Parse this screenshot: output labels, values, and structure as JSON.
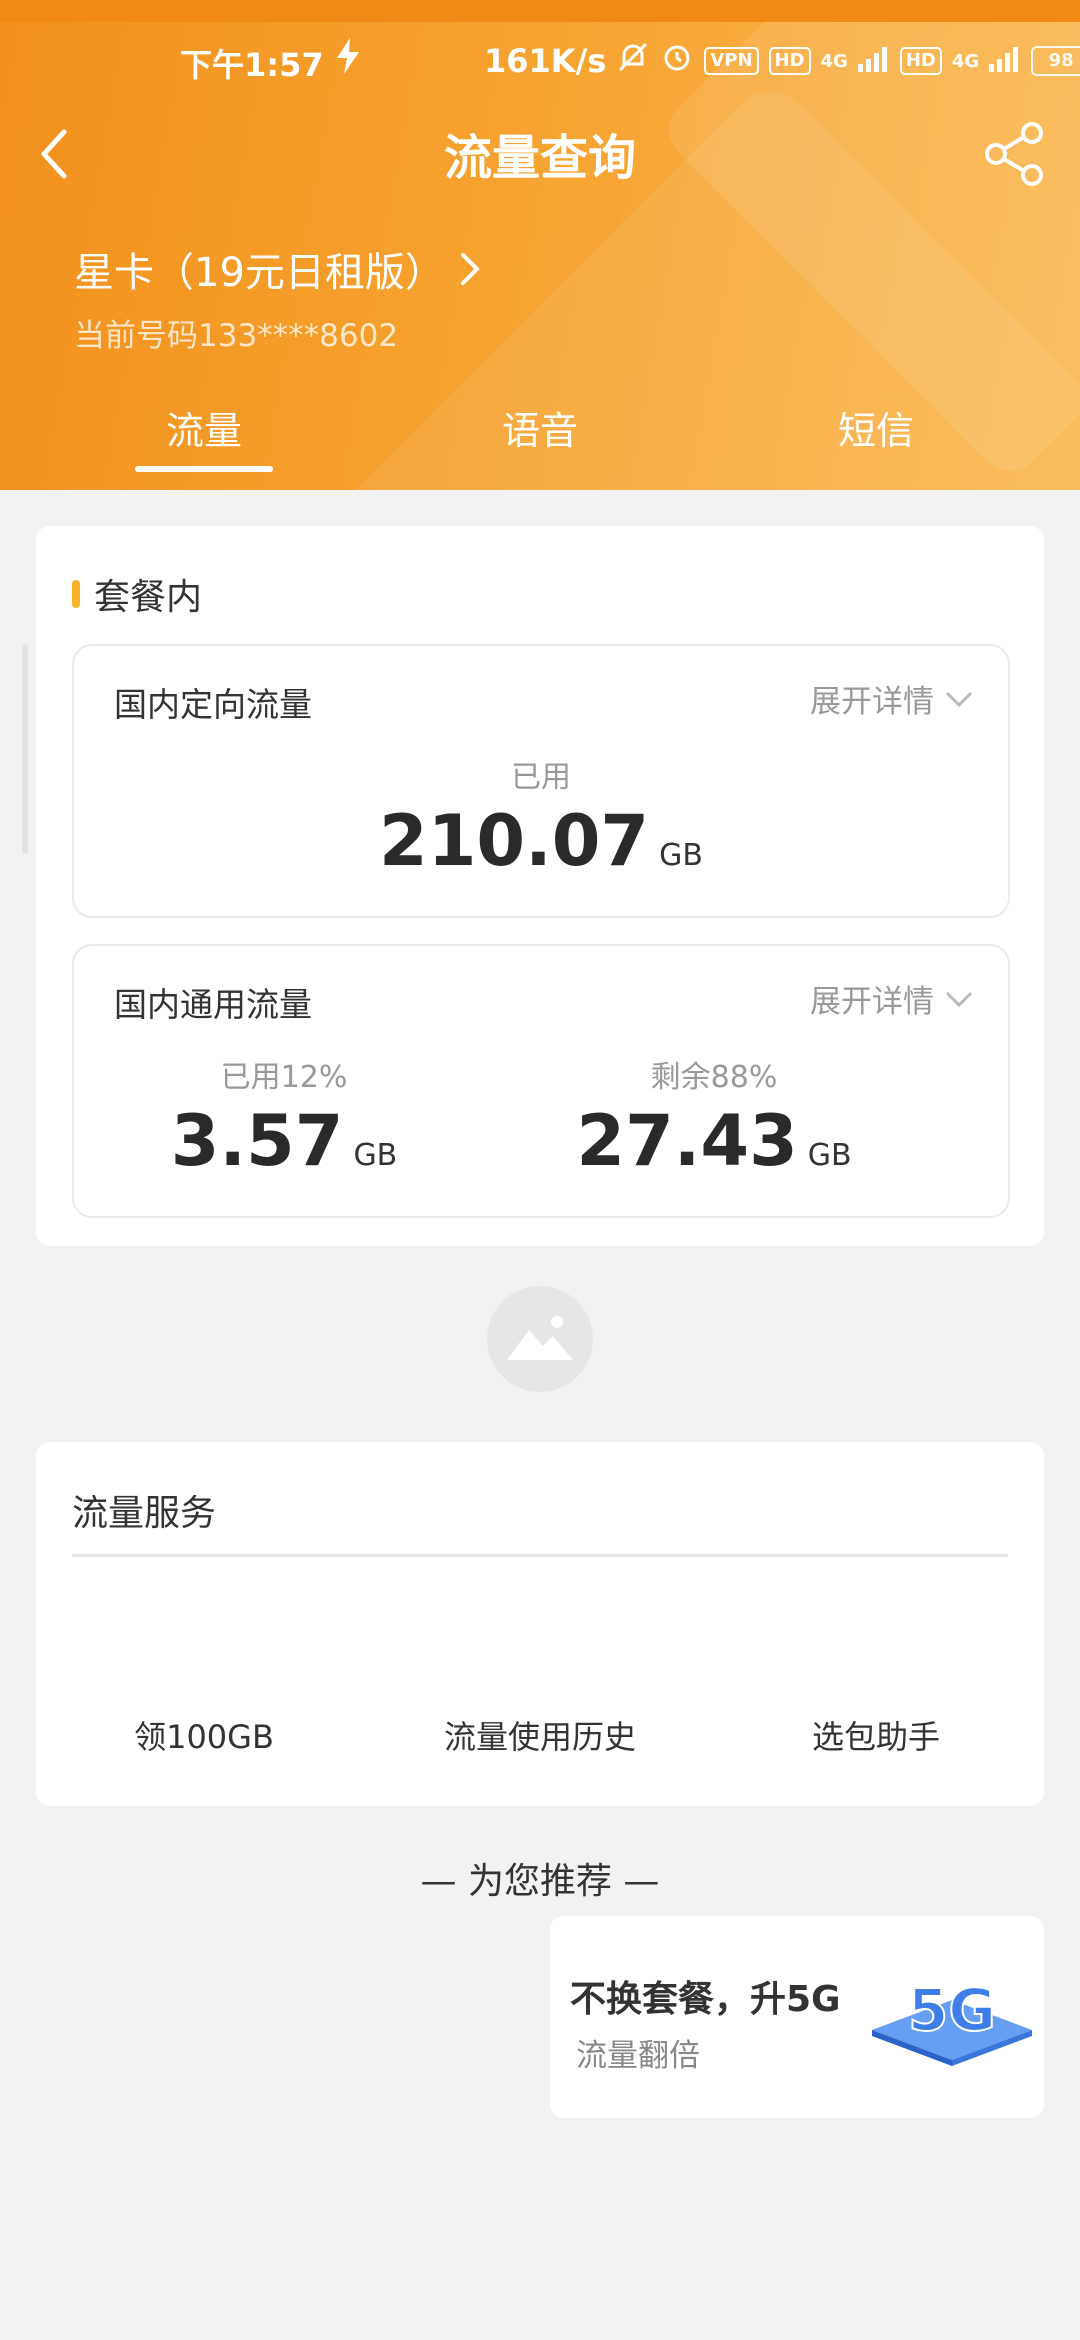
{
  "status": {
    "time": "下午1:57",
    "speed": "161K/s",
    "vpn": "VPN",
    "hd1": "HD",
    "hd2": "HD",
    "net1": "4G",
    "net2": "4G",
    "battery": "98"
  },
  "header": {
    "title": "流量查询",
    "plan_name": "星卡（19元日租版）",
    "phone_line": "当前号码133****8602",
    "tabs": [
      "流量",
      "语音",
      "短信"
    ]
  },
  "package": {
    "section_title": "套餐内",
    "directional": {
      "title": "国内定向流量",
      "expand": "展开详情",
      "used_label": "已用",
      "used_value": "210.07",
      "unit": "GB"
    },
    "general": {
      "title": "国内通用流量",
      "expand": "展开详情",
      "used_label": "已用12%",
      "used_value": "3.57",
      "remain_label": "剩余88%",
      "remain_value": "27.43",
      "unit": "GB"
    }
  },
  "services": {
    "title": "流量服务",
    "items": [
      "领100GB",
      "流量使用历史",
      "选包助手"
    ]
  },
  "recommend": {
    "heading": "— 为您推荐 —",
    "promo_title": "不换套餐，升5G",
    "promo_sub": "流量翻倍",
    "badge": "5G"
  },
  "colors": {
    "header_start": "#f2901c",
    "header_end": "#fbb850",
    "accent_bar": "#f7b12a"
  }
}
